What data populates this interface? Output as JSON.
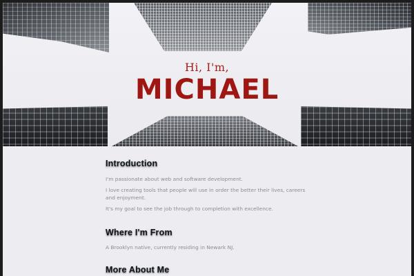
{
  "hero": {
    "greeting": "Hi, I'm,",
    "name": "MICHAEL"
  },
  "sections": {
    "intro": {
      "title": "Introduction",
      "paragraphs": [
        "I'm passionate about web and software development.",
        "I love creating tools that people will use in order the better their lives, careers and enjoyment.",
        "It's my goal to see the job through to completion with excellence."
      ]
    },
    "where": {
      "title": "Where I'm From",
      "paragraphs": [
        "A Brooklyn native, currently residing in Newark NJ."
      ]
    },
    "more": {
      "title": "More About Me"
    }
  },
  "colors": {
    "accent": "#9e1712",
    "heading": "#0d1218",
    "body_text": "#8a8d94",
    "background": "#ececf1"
  }
}
